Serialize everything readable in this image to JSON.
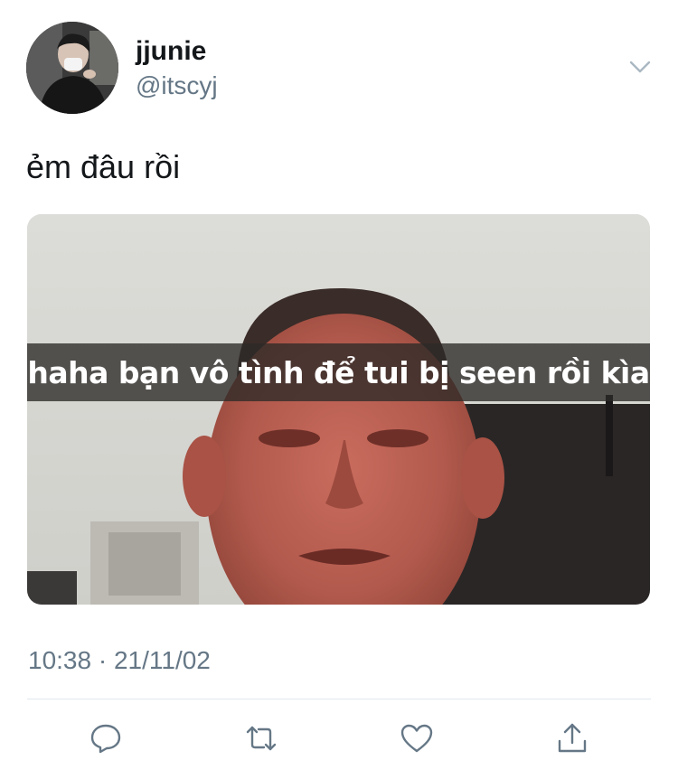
{
  "tweet": {
    "author": {
      "display_name": "jjunie",
      "handle": "@itscyj"
    },
    "text": "ẻm đâu rồi",
    "media": {
      "caption": "haha bạn vô tình để tui bị seen rồi kìa"
    },
    "timestamp": "10:38 · 21/11/02"
  },
  "actions": {
    "icons": [
      "reply-icon",
      "retweet-icon",
      "like-icon",
      "share-icon"
    ]
  },
  "colors": {
    "text_primary": "#14171a",
    "text_secondary": "#657786",
    "divider": "#e1e8ed",
    "icon_gray": "#657786",
    "chevron": "#aab8c2"
  }
}
